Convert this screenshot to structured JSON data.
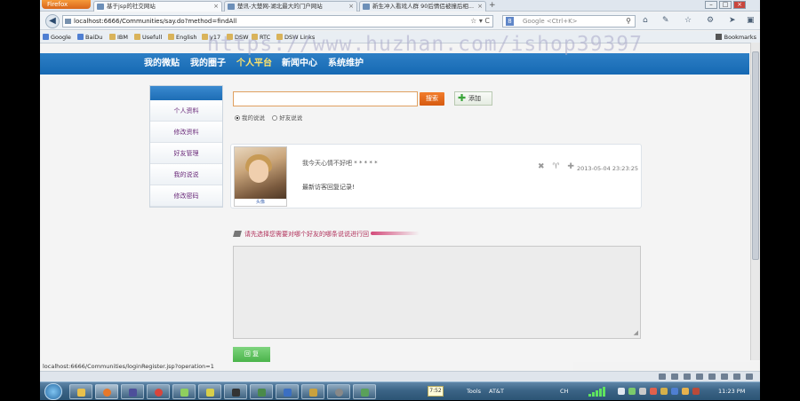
{
  "browser": {
    "menu_label": "Firefox",
    "tabs": [
      {
        "label": "基于jsp的社交网站",
        "active": true
      },
      {
        "label": "楚讯-大楚网-湖北最大的门户网站",
        "active": false
      },
      {
        "label": "新生冲入看戏人群 90后情侣被撞后相...",
        "active": false
      }
    ],
    "new_tab": "+",
    "window_controls": {
      "minimize": "–",
      "maximize": "□",
      "close": "×"
    },
    "url": "localhost:6666/Communities/say.do?method=findAll",
    "url_icons": "☆ ▾ C",
    "search_placeholder": "Google <Ctrl+K>",
    "search_engine_letter": "8",
    "bookmarks": [
      "Google",
      "BaiDu",
      "IBM",
      "Usefull",
      "English",
      "y17",
      "DSW",
      "RTC",
      "DSW Links"
    ],
    "bookmarks_right": "Bookmarks",
    "status_url": "localhost:6666/Communities/loginRegister.jsp?operation=1"
  },
  "watermark": "https://www.huzhan.com/ishop39397",
  "site_nav": {
    "items": [
      "我的微贴",
      "我的圈子",
      "个人平台",
      "新闻中心",
      "系统维护"
    ],
    "current_index": 2
  },
  "side_menu": {
    "items": [
      "个人资料",
      "修改资料",
      "好友管理",
      "我的说说",
      "修改密码"
    ]
  },
  "search": {
    "value": "",
    "button": "搜索",
    "add_button": "添加"
  },
  "filter": {
    "options": [
      "我的说说",
      "好友说说"
    ],
    "selected": 0
  },
  "post": {
    "avatar_caption": "头像",
    "text": "我今天心情不好吧 * * * * *",
    "reply": "最新访客回复记录!",
    "actions": [
      "✖",
      "♈",
      "✚"
    ],
    "time": "2013-05-04 23:23:25"
  },
  "hint": "请先选择您需要对哪个好友的哪条说说进行回",
  "textarea_value": "",
  "submit_button": "回 复",
  "taskbar": {
    "clock_label": "7:52",
    "tools_label": "Tools",
    "carrier": "AT&T",
    "lang": "CH",
    "time": "11:23 PM"
  },
  "colors": {
    "nav_blue": "#1669b3",
    "nav_current": "#ffe36b",
    "search_orange": "#e06a1a",
    "submit_green": "#5cbf5c",
    "hint_red": "#b0305a"
  }
}
